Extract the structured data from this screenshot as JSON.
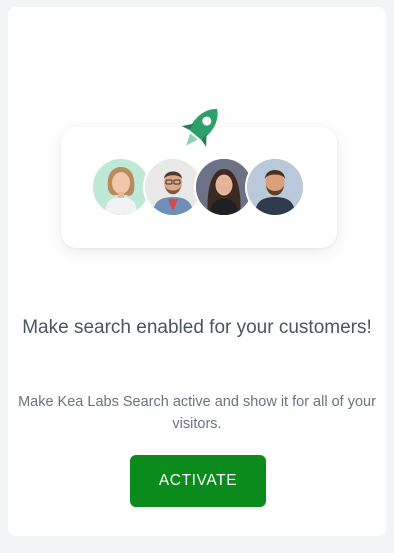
{
  "card": {
    "title": "Make search enabled for your customers!",
    "subtitle": "Make Kea Labs Search active and show it for all of your visitors.",
    "activate_label": "ACTIVATE"
  },
  "illustration": {
    "icon": "rocket-icon",
    "avatars": [
      "avatar-woman-1",
      "avatar-man-1",
      "avatar-woman-2",
      "avatar-man-2"
    ]
  },
  "colors": {
    "accent": "#0a8b1c",
    "rocket": "#2e9e6a",
    "title_text": "#4d5461",
    "body_text": "#6b7280",
    "page_background": "#f3f4f5"
  }
}
